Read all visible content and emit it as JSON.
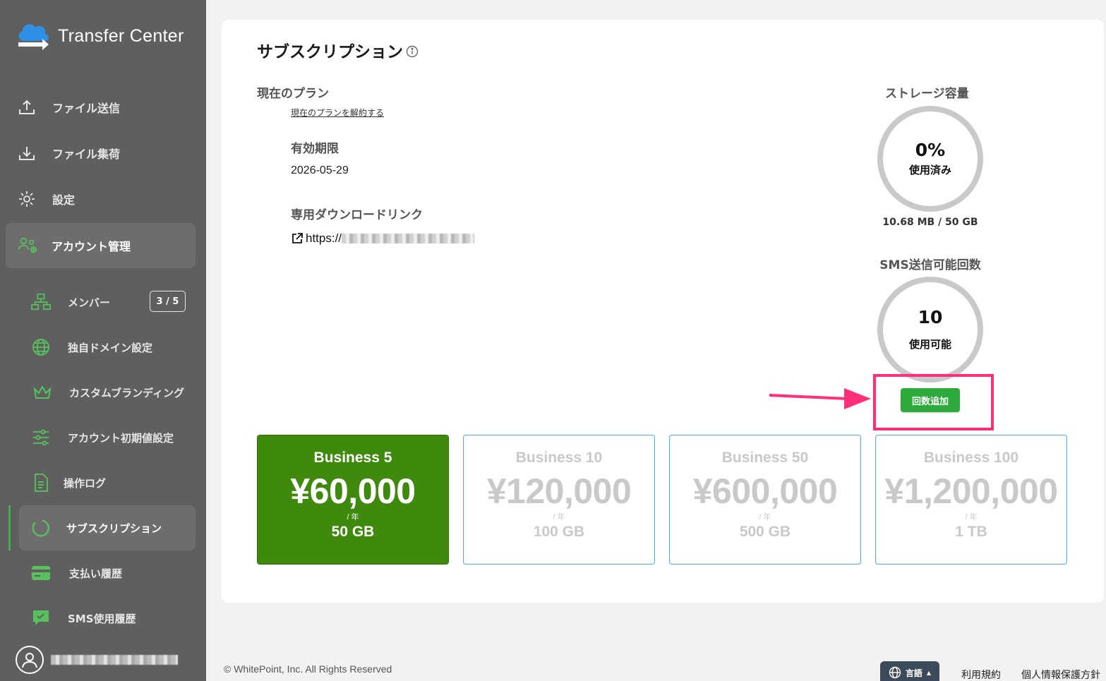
{
  "app": {
    "title": "Transfer Center"
  },
  "sidebar": {
    "items": [
      {
        "label": "ファイル送信",
        "icon": "upload-icon"
      },
      {
        "label": "ファイル集荷",
        "icon": "download-icon"
      },
      {
        "label": "設定",
        "icon": "gear-icon"
      },
      {
        "label": "アカウント管理",
        "icon": "account-manage-icon"
      }
    ],
    "sub_items": [
      {
        "label": "メンバー",
        "icon": "members-icon",
        "badge": "3 / 5"
      },
      {
        "label": "独自ドメイン設定",
        "icon": "globe-icon"
      },
      {
        "label": "カスタムブランディング",
        "icon": "crown-icon"
      },
      {
        "label": "アカウント初期値設定",
        "icon": "sliders-icon"
      },
      {
        "label": "操作ログ",
        "icon": "document-icon"
      },
      {
        "label": "サブスクリプション",
        "icon": "circle-progress-icon"
      },
      {
        "label": "支払い履歴",
        "icon": "credit-card-icon"
      },
      {
        "label": "SMS使用履歴",
        "icon": "chat-check-icon"
      }
    ]
  },
  "main": {
    "title": "サブスクリプション",
    "current_plan_label": "現在のプラン",
    "cancel_link": "現在のプランを解約する",
    "expiry_label": "有効期限",
    "expiry_value": "2026-05-29",
    "download_link_label": "専用ダウンロードリンク",
    "download_link_prefix": "https://",
    "storage": {
      "label": "ストレージ容量",
      "percent": "0%",
      "used_label": "使用済み",
      "usage": "10.68 MB / 50 GB"
    },
    "sms": {
      "label": "SMS送信可能回数",
      "count": "10",
      "available_label": "使用可能",
      "add_button": "回数追加"
    },
    "plans": [
      {
        "name": "Business 5",
        "price": "¥60,000",
        "period": "/ 年",
        "size": "50 GB",
        "selected": true
      },
      {
        "name": "Business 10",
        "price": "¥120,000",
        "period": "/ 年",
        "size": "100 GB",
        "selected": false
      },
      {
        "name": "Business 50",
        "price": "¥600,000",
        "period": "/ 年",
        "size": "500 GB",
        "selected": false
      },
      {
        "name": "Business 100",
        "price": "¥1,200,000",
        "period": "/ 年",
        "size": "1 TB",
        "selected": false
      }
    ]
  },
  "footer": {
    "copyright": "© WhitePoint, Inc. All Rights Reserved",
    "language_button": "言語",
    "terms": "利用規約",
    "privacy": "個人情報保護方針"
  },
  "colors": {
    "sidebar_bg": "#5f5f5f",
    "accent_green": "#2eaa3c",
    "selected_plan": "#3f8a0d",
    "highlight": "#ff2f7a",
    "plan_border": "#4aa7e8"
  }
}
